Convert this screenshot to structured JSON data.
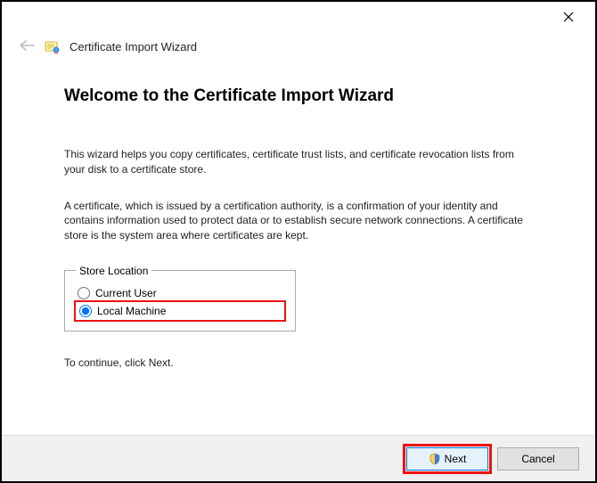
{
  "header": {
    "wizard_title": "Certificate Import Wizard"
  },
  "main": {
    "heading": "Welcome to the Certificate Import Wizard",
    "paragraph1": "This wizard helps you copy certificates, certificate trust lists, and certificate revocation lists from your disk to a certificate store.",
    "paragraph2": "A certificate, which is issued by a certification authority, is a confirmation of your identity and contains information used to protect data or to establish secure network connections. A certificate store is the system area where certificates are kept.",
    "store_location": {
      "legend": "Store Location",
      "options": {
        "current_user": "Current User",
        "local_machine": "Local Machine"
      },
      "selected": "local_machine"
    },
    "continue_text": "To continue, click Next."
  },
  "footer": {
    "next_label": "Next",
    "cancel_label": "Cancel"
  }
}
